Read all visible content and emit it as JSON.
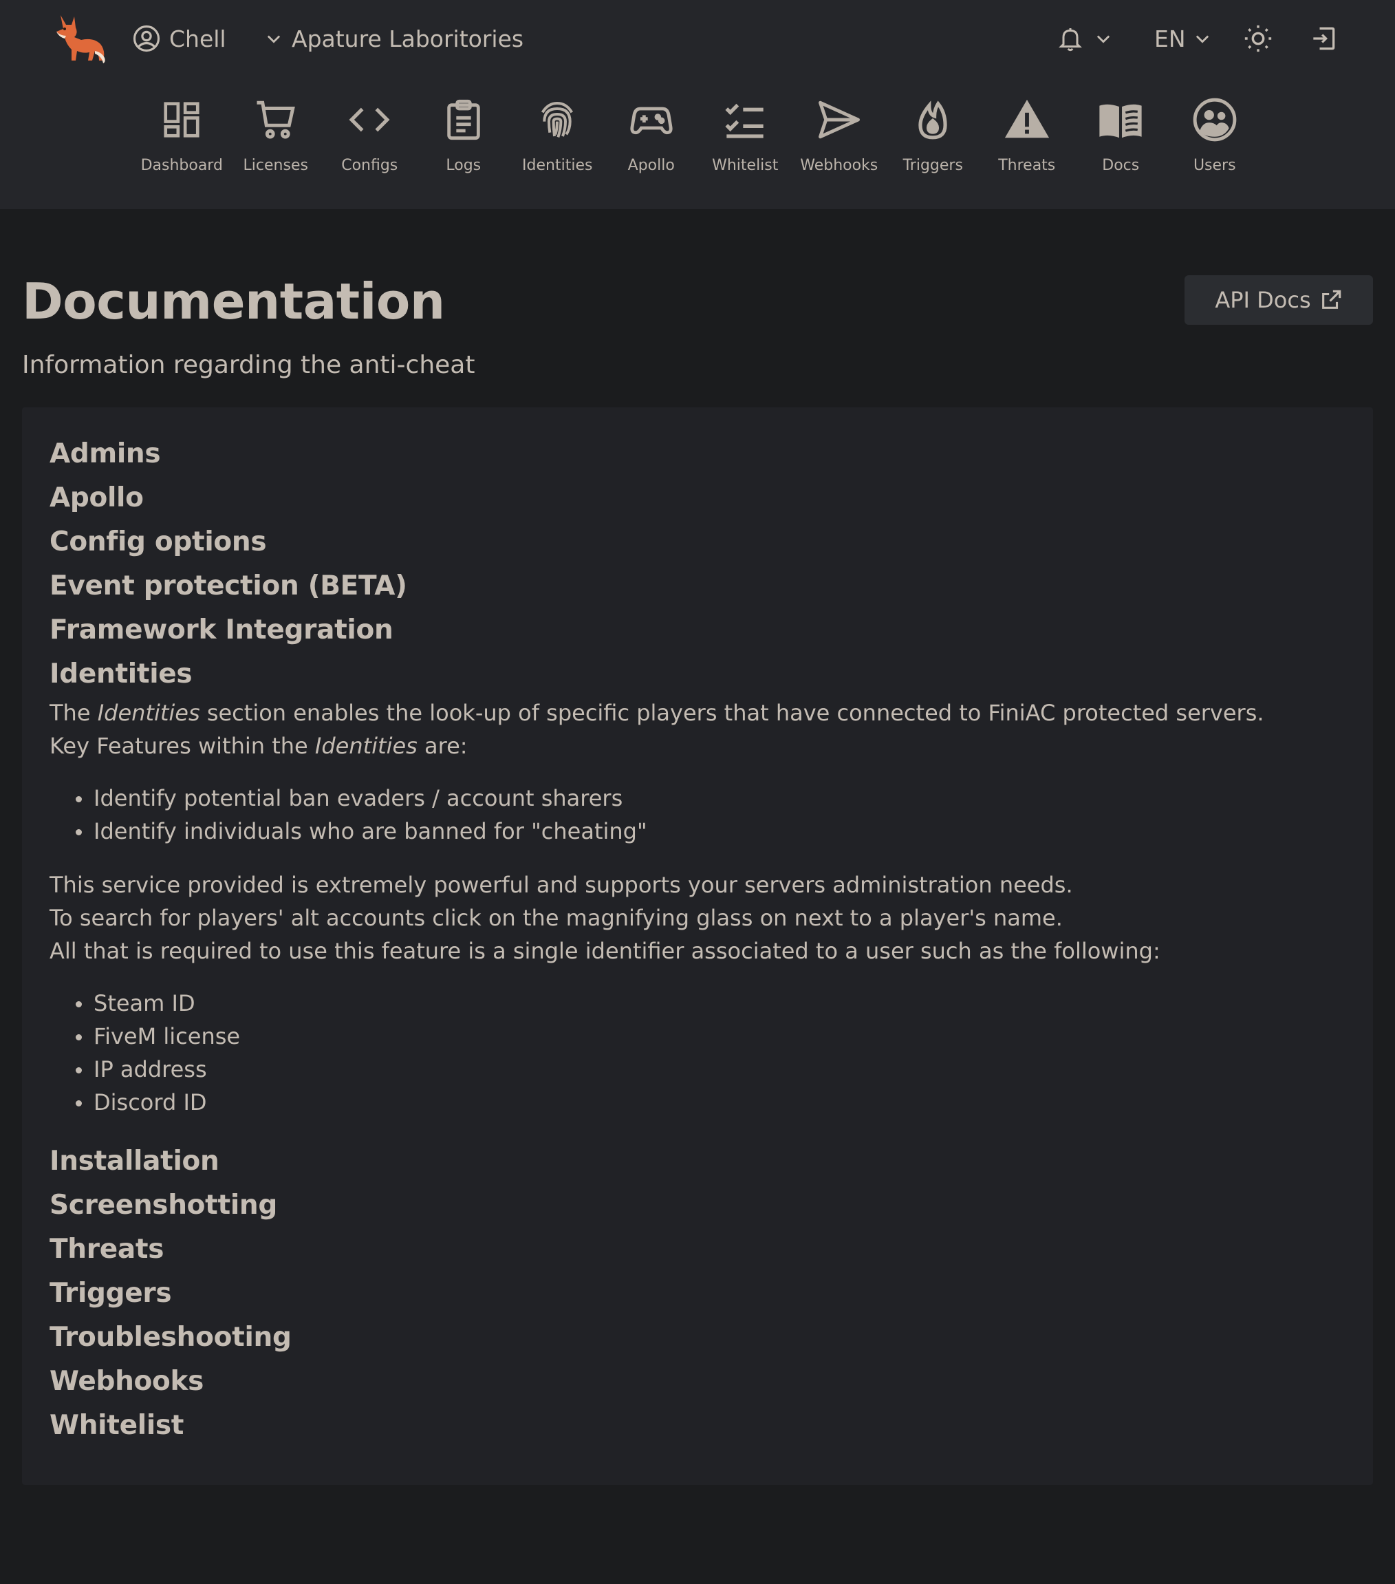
{
  "header": {
    "user_name": "Chell",
    "org_name": "Apature Laboritories",
    "language": "EN"
  },
  "nav": [
    {
      "label": "Dashboard",
      "icon": "dashboard-icon"
    },
    {
      "label": "Licenses",
      "icon": "cart-icon"
    },
    {
      "label": "Configs",
      "icon": "code-icon"
    },
    {
      "label": "Logs",
      "icon": "clipboard-icon"
    },
    {
      "label": "Identities",
      "icon": "fingerprint-icon"
    },
    {
      "label": "Apollo",
      "icon": "gamepad-icon"
    },
    {
      "label": "Whitelist",
      "icon": "checklist-icon"
    },
    {
      "label": "Webhooks",
      "icon": "send-icon"
    },
    {
      "label": "Triggers",
      "icon": "flame-icon"
    },
    {
      "label": "Threats",
      "icon": "warning-icon"
    },
    {
      "label": "Docs",
      "icon": "book-icon"
    },
    {
      "label": "Users",
      "icon": "users-icon"
    }
  ],
  "page": {
    "title": "Documentation",
    "subtitle": "Information regarding the anti-cheat",
    "api_docs_label": "API Docs"
  },
  "sections": {
    "admins": "Admins",
    "apollo": "Apollo",
    "config_options": "Config options",
    "event_protection": "Event protection (BETA)",
    "framework_integration": "Framework Integration",
    "identities": "Identities",
    "installation": "Installation",
    "screenshotting": "Screenshotting",
    "threats": "Threats",
    "triggers": "Triggers",
    "troubleshooting": "Troubleshooting",
    "webhooks": "Webhooks",
    "whitelist": "Whitelist"
  },
  "identities": {
    "p1_prefix": "The ",
    "p1_em": "Identities",
    "p1_suffix": " section enables the look-up of specific players that have connected to FiniAC protected servers.",
    "p2_prefix": "Key Features within the ",
    "p2_em": "Identities",
    "p2_suffix": " are:",
    "features": [
      "Identify potential ban evaders / account sharers",
      "Identify individuals who are banned for \"cheating\""
    ],
    "p3": "This service provided is extremely powerful and supports your servers administration needs.",
    "p4": "To search for players' alt accounts click on the magnifying glass on next to a player's name.",
    "p5": "All that is required to use this feature is a single identifier associated to a user such as the following:",
    "identifiers": [
      "Steam ID",
      "FiveM license",
      "IP address",
      "Discord ID"
    ]
  },
  "colors": {
    "background": "#1b1c1e",
    "header": "#25262a",
    "card": "#212226",
    "text": "#c4bcb3",
    "logo_orange": "#e0693a"
  }
}
